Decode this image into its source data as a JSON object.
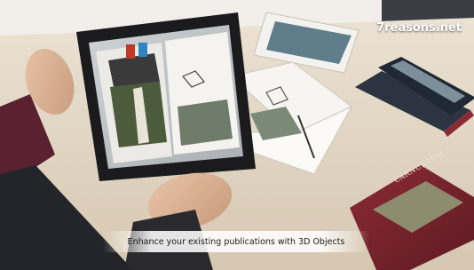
{
  "watermark": "7reasons.net",
  "caption": "Enhance your existing publications with 3D Objects",
  "book_cover_title": "CARNUNTUM",
  "colors": {
    "table": "#e2d6c3",
    "wall": "#f2efea",
    "tablet_frame": "#1b1b1d",
    "book_maroon": "#7a2530"
  }
}
